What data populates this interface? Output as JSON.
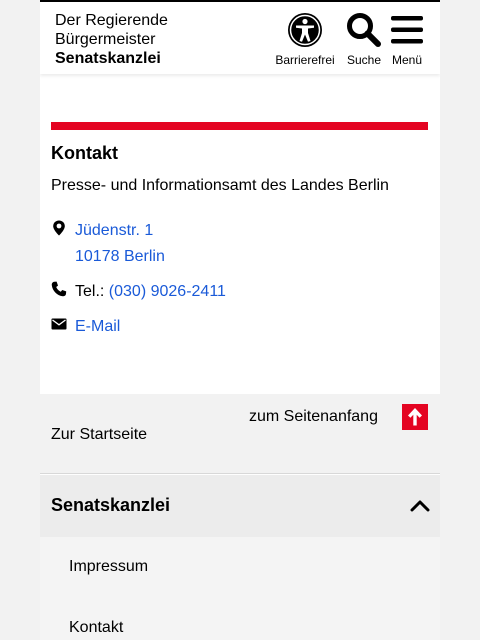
{
  "header": {
    "brand_line1": "Der Regierende",
    "brand_line2": "Bürgermeister",
    "brand_line3": "Senatskanzlei",
    "accessibility_label": "Barrierefrei",
    "search_label": "Suche",
    "menu_label": "Menü"
  },
  "contact": {
    "title": "Kontakt",
    "organization": "Presse- und Informationsamt des Landes Berlin",
    "street": "Jüdenstr. 1",
    "city": "10178 Berlin",
    "tel_prefix": "Tel.:",
    "tel": "(030) 9026-2411",
    "email": "E-Mail"
  },
  "footer": {
    "back_to_top": "zum Seitenanfang",
    "home": "Zur Startseite",
    "section_title": "Senatskanzlei",
    "links": [
      "Impressum",
      "Kontakt"
    ]
  },
  "colors": {
    "accent_red": "#e40422",
    "link_blue": "#1a5ad8"
  },
  "icons": [
    "accessibility-icon",
    "search-icon",
    "menu-icon",
    "location-pin-icon",
    "phone-icon",
    "envelope-icon",
    "arrow-up-icon",
    "chevron-up-icon"
  ]
}
